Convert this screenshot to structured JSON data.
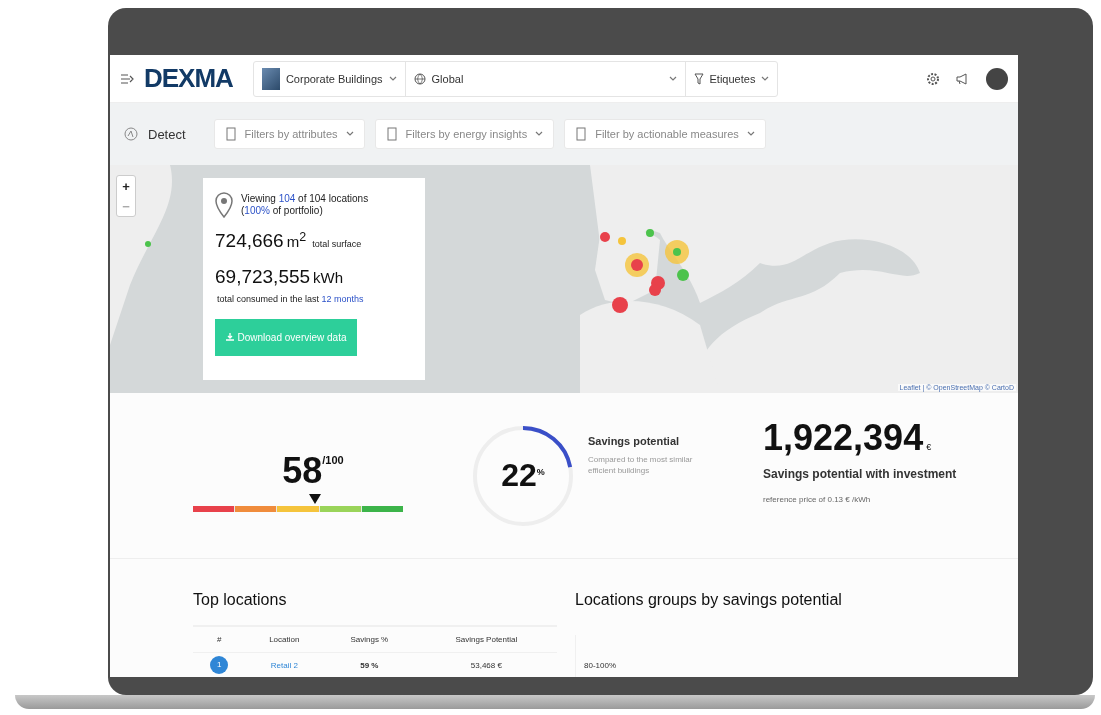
{
  "header": {
    "logo": "DEXMA",
    "building": "Corporate Buildings",
    "region": "Global",
    "tags": "Etiquetes"
  },
  "toolbar": {
    "title": "Detect",
    "filters": [
      "Filters by attributes",
      "Filters by energy insights",
      "Filter by actionable measures"
    ]
  },
  "map": {
    "zoom_in": "+",
    "zoom_out": "−",
    "attribution": "Leaflet | © OpenStreetMap © CartoD"
  },
  "summary": {
    "viewing": {
      "before": "Viewing",
      "link": "104",
      "after": "of  104  locations"
    },
    "portfolio": {
      "before": "(",
      "link": "100%",
      "after": "of portfolio)"
    },
    "surface": {
      "value": "724,666",
      "unit": "m$^{2}$",
      "label": "total surface"
    },
    "consumption": {
      "value": "69,723,555",
      "unit": "kWh",
      "label": "total consumed in the last",
      "link": "12 months"
    },
    "button": "Download overview data"
  },
  "score": {
    "value": "58",
    "max": "/100",
    "level": 0.58,
    "segments": [
      {
        "color": "#e8414b"
      },
      {
        "color": "#f08c3c"
      },
      {
        "color": "#f5c43c"
      },
      {
        "color": "#9ad45a"
      },
      {
        "color": "#3cb44a"
      }
    ]
  },
  "gauge": {
    "value": "22",
    "unit": "%",
    "level": 0.22,
    "title": "Savings potential",
    "description": "Compared to the most similar efficient buildings"
  },
  "investment": {
    "value": "1,922,394",
    "unit": "€",
    "title": "Savings potential with investment",
    "note": "reference price of 0.13 € /kWh"
  },
  "top_locations": {
    "title": "Top locations",
    "columns": [
      "#",
      "Location",
      "Savings %",
      "Savings Potential"
    ],
    "rows": [
      {
        "rank": "1",
        "location": "Retail 2",
        "savings": "59 %",
        "potential": "53,468 €"
      }
    ]
  },
  "groups": {
    "title": "Locations groups by savings potential",
    "categories": [
      "80-100%"
    ]
  }
}
